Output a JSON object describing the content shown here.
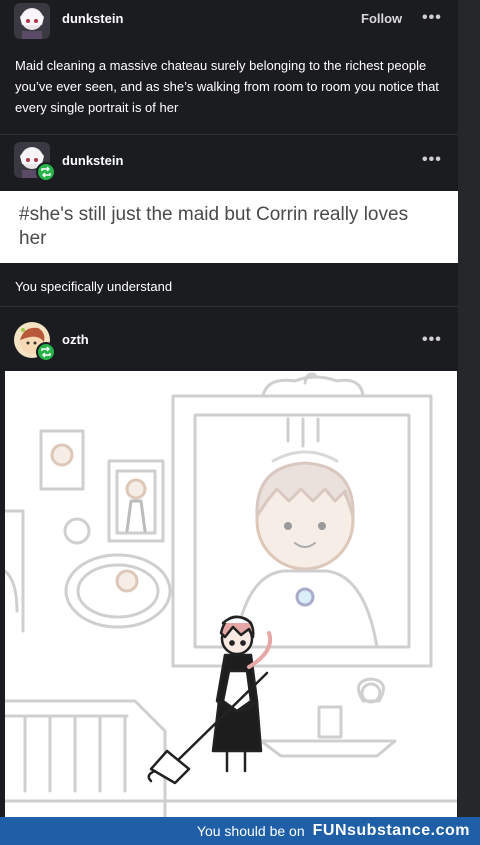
{
  "posts": [
    {
      "username": "dunkstein",
      "follow_label": "Follow",
      "body": "Maid cleaning a massive chateau surely belonging to the richest people you’ve ever seen, and as she’s walking from room to room you notice that every single portrait is of her"
    },
    {
      "username": "dunkstein",
      "tags": "#she's still just the maid but Corrin really loves her"
    },
    {
      "username": "ozth",
      "body": "You specifically understand"
    }
  ],
  "more_options": "•••",
  "footer": {
    "prefix": "You should be on",
    "brand": "FUNsubstance.com"
  },
  "colors": {
    "background": "#1b1c1f",
    "reblog_badge": "#27b34a",
    "footer": "#1f5fa8"
  }
}
